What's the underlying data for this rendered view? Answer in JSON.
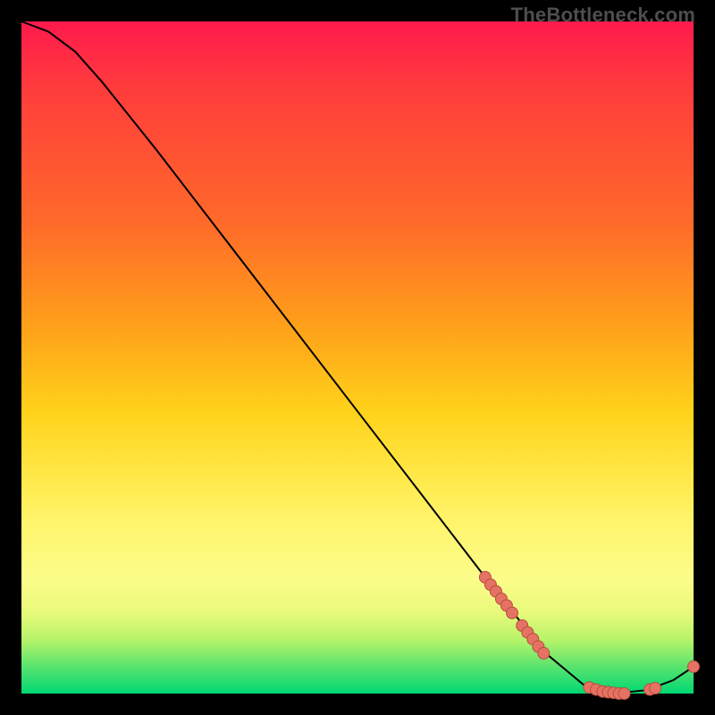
{
  "watermark": "TheBottleneck.com",
  "colors": {
    "curve_stroke": "#000000",
    "marker_fill": "#e57363",
    "marker_stroke": "#b94d3f"
  },
  "chart_data": {
    "type": "line",
    "title": "",
    "xlabel": "",
    "ylabel": "",
    "xlim": [
      0,
      100
    ],
    "ylim": [
      0,
      100
    ],
    "grid": false,
    "legend": false,
    "curve_points": [
      {
        "x": 0,
        "y": 100
      },
      {
        "x": 4,
        "y": 98.5
      },
      {
        "x": 8,
        "y": 95.5
      },
      {
        "x": 12,
        "y": 91
      },
      {
        "x": 20,
        "y": 81
      },
      {
        "x": 30,
        "y": 68
      },
      {
        "x": 40,
        "y": 55
      },
      {
        "x": 50,
        "y": 42
      },
      {
        "x": 60,
        "y": 29
      },
      {
        "x": 70,
        "y": 16
      },
      {
        "x": 78,
        "y": 6
      },
      {
        "x": 84,
        "y": 1
      },
      {
        "x": 88,
        "y": 0
      },
      {
        "x": 93,
        "y": 0.5
      },
      {
        "x": 97,
        "y": 2
      },
      {
        "x": 100,
        "y": 4
      }
    ],
    "markers": [
      {
        "x": 69.0,
        "y": 17.3
      },
      {
        "x": 69.8,
        "y": 16.2
      },
      {
        "x": 70.6,
        "y": 15.2
      },
      {
        "x": 71.4,
        "y": 14.1
      },
      {
        "x": 72.2,
        "y": 13.1
      },
      {
        "x": 73.0,
        "y": 12.0
      },
      {
        "x": 74.5,
        "y": 10.1
      },
      {
        "x": 75.3,
        "y": 9.1
      },
      {
        "x": 76.1,
        "y": 8.1
      },
      {
        "x": 76.9,
        "y": 7.0
      },
      {
        "x": 77.7,
        "y": 6.0
      },
      {
        "x": 84.5,
        "y": 0.9
      },
      {
        "x": 85.5,
        "y": 0.6
      },
      {
        "x": 86.5,
        "y": 0.3
      },
      {
        "x": 87.3,
        "y": 0.2
      },
      {
        "x": 88.1,
        "y": 0.1
      },
      {
        "x": 88.9,
        "y": 0.0
      },
      {
        "x": 89.7,
        "y": 0.0
      },
      {
        "x": 93.5,
        "y": 0.6
      },
      {
        "x": 94.3,
        "y": 0.8
      },
      {
        "x": 100.0,
        "y": 4.0
      }
    ]
  }
}
